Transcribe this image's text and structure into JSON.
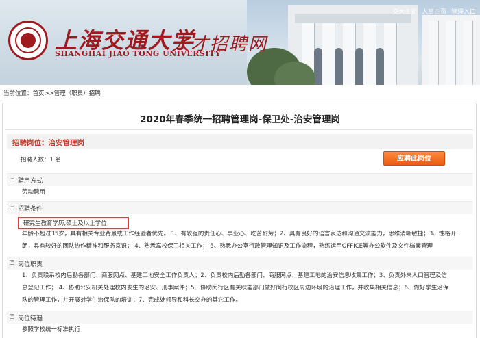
{
  "header": {
    "university_cn": "上海交通大学",
    "university_en": "SHANGHAI JIAO TONG UNIVERSITY",
    "site_name": "人才招聘网",
    "top_links": [
      "交大主页",
      "人事主页",
      "管理入口"
    ]
  },
  "breadcrumb": "当前位置：首页>>管理（职员）招聘",
  "job": {
    "title": "2020年春季统一招聘管理岗-保卫处-治安管理岗",
    "position_label": "招聘岗位：治安管理岗",
    "headcount_text": "招聘人数：1 名",
    "apply_button": "应聘此岗位"
  },
  "sections": {
    "employment_type": {
      "title": "聘用方式",
      "body": "劳动聘用"
    },
    "requirements": {
      "title": "招聘条件",
      "highlight_text": "研究生教育学历,硕士及以上学位",
      "line1": "年龄不超过35岁，具有相关专业背景或工作经验者优先。 1、有较强的责任心、事业心、吃苦耐劳；2、具有良好的语言表达和沟通交流能力，思维清晰敏捷；3、性格开",
      "line2": "朗，具有较好的团队协作精神和服务意识；  4、熟悉高校保卫相关工作；  5、熟悉办公室行政管理知识及工作流程，熟练运用OFFICE等办公软件及文件档案管理"
    },
    "duties": {
      "title": "岗位职责",
      "line1": "1、负责联系校内后勤各部门、商服网点、基建工地安全工作负责人；2、负责校内后勤各部门、商服网点、基建工地的治安信息收集工作；3、负责外来人口管理及信",
      "line2": "息登记工作；  4、协助公安机关处理校内发生的治安、刑事案件；5、协助闵行区有关职能部门做好闵行校区周边环境的治理工作，并收集相关信息；6、做好学生治保",
      "line3": "队的管理工作，并开展对学生治保队的培训；7、完成处领导和科长交办的其它工作。"
    },
    "benefits": {
      "title": "岗位待遇",
      "body": "参照学校统一标准执行"
    }
  },
  "colors": {
    "brand_red": "#9e1a1f",
    "position_red": "#c0392b",
    "apply_orange": "#ea5b12",
    "highlight_border": "#e23b3b"
  }
}
